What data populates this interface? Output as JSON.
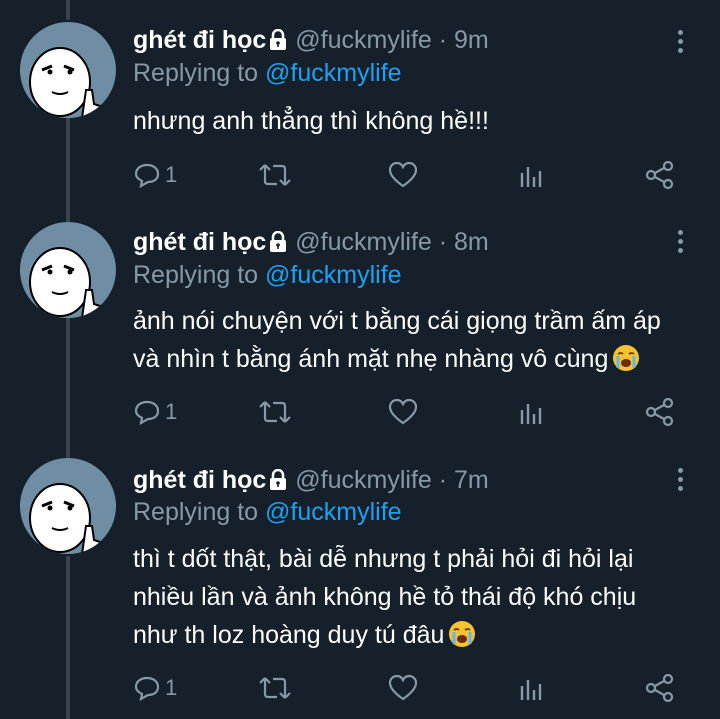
{
  "tweets": [
    {
      "name": "ghét đi học",
      "handle": "@fuckmylife",
      "dot": "·",
      "time": "9m",
      "replying_prefix": "Replying to ",
      "replying_to": "@fuckmylife",
      "lines": [
        "nhưng anh thẳng thì không hề!!!"
      ],
      "has_emoji": false,
      "reply_count": "1"
    },
    {
      "name": "ghét đi học",
      "handle": "@fuckmylife",
      "dot": "·",
      "time": "8m",
      "replying_prefix": "Replying to ",
      "replying_to": "@fuckmylife",
      "lines": [
        "ảnh nói chuyện với t bằng cái giọng trầm ấm áp",
        "và nhìn t bằng ánh mặt nhẹ nhàng vô cùng"
      ],
      "has_emoji": true,
      "reply_count": "1"
    },
    {
      "name": "ghét đi học",
      "handle": "@fuckmylife",
      "dot": "·",
      "time": "7m",
      "replying_prefix": "Replying to ",
      "replying_to": "@fuckmylife",
      "lines": [
        "thì t dốt thật, bài dễ nhưng t phải hỏi đi hỏi lại",
        "nhiều lần và ảnh không hề tỏ thái độ khó chịu",
        "như th loz hoàng duy tú đâu"
      ],
      "has_emoji": true,
      "reply_count": "1"
    }
  ],
  "icons": {
    "lock": "lock-icon",
    "more": "more-vertical-icon",
    "reply": "reply-icon",
    "retweet": "retweet-icon",
    "like": "heart-icon",
    "analytics": "analytics-icon",
    "share": "share-icon",
    "emoji": "loudly-crying-face-emoji"
  },
  "colors": {
    "background": "#15202b",
    "secondary_text": "#8899a6",
    "link": "#1da1f2",
    "thread_line": "#38444d"
  }
}
